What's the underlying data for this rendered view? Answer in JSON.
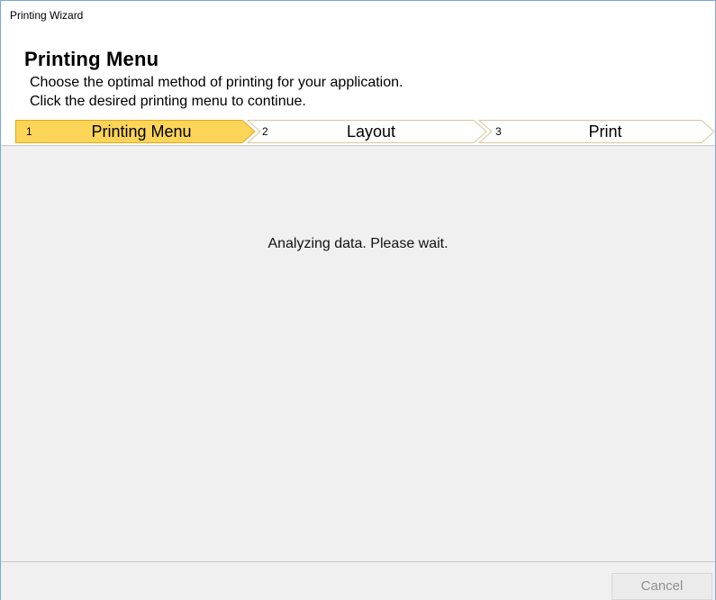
{
  "window": {
    "title": "Printing Wizard"
  },
  "header": {
    "title": "Printing Menu",
    "description_line1": "Choose the optimal method of printing for your application.",
    "description_line2": "Click the desired printing menu to continue."
  },
  "steps": [
    {
      "number": "1",
      "label": "Printing Menu",
      "active": true
    },
    {
      "number": "2",
      "label": "Layout",
      "active": false
    },
    {
      "number": "3",
      "label": "Print",
      "active": false
    }
  ],
  "content": {
    "status": "Analyzing data. Please wait."
  },
  "footer": {
    "cancel_label": "Cancel"
  },
  "colors": {
    "active_step_fill": "#fcd558",
    "active_step_border": "#e0a81e",
    "inactive_step_fill": "#ffffff",
    "inactive_step_border": "#d6c79a",
    "content_background": "#f0f0f0"
  }
}
